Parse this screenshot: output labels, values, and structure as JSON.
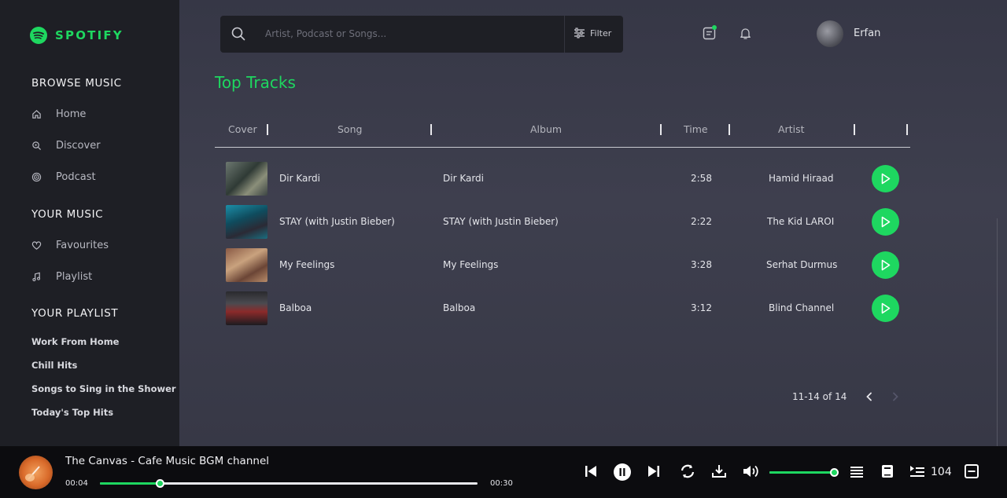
{
  "brand": {
    "name": "SPOTIFY",
    "color": "#1ed760"
  },
  "sidebar": {
    "browse_title": "BROWSE MUSIC",
    "browse_items": [
      {
        "label": "Home",
        "icon": "home-icon"
      },
      {
        "label": "Discover",
        "icon": "discover-icon"
      },
      {
        "label": "Podcast",
        "icon": "podcast-icon"
      }
    ],
    "your_music_title": "YOUR MUSIC",
    "your_music_items": [
      {
        "label": "Favourites",
        "icon": "heart-icon"
      },
      {
        "label": "Playlist",
        "icon": "music-note-icon"
      }
    ],
    "playlist_title": "YOUR PLAYLIST",
    "playlists": [
      "Work From Home",
      "Chill Hits",
      "Songs to Sing in the Shower",
      "Today's Top Hits"
    ]
  },
  "header": {
    "search_placeholder": "Artist, Podcast or Songs...",
    "filter_label": "Filter",
    "user_name": "Erfan"
  },
  "main": {
    "title": "Top Tracks",
    "columns": [
      "Cover",
      "Song",
      "Album",
      "Time",
      "Artist"
    ],
    "tracks": [
      {
        "song": "Dir Kardi",
        "album": "Dir Kardi",
        "time": "2:58",
        "artist": "Hamid Hiraad"
      },
      {
        "song": "STAY (with Justin Bieber)",
        "album": "STAY (with Justin Bieber)",
        "time": "2:22",
        "artist": "The Kid LAROI"
      },
      {
        "song": "My Feelings",
        "album": "My Feelings",
        "time": "3:28",
        "artist": "Serhat Durmus"
      },
      {
        "song": "Balboa",
        "album": "Balboa",
        "time": "3:12",
        "artist": "Blind Channel"
      }
    ],
    "pagination": "11-14 of 14"
  },
  "player": {
    "now_playing": "The Canvas - Cafe Music BGM channel",
    "current_time": "00:04",
    "duration": "00:30",
    "progress_fraction": 0.16,
    "volume_fraction": 1.0,
    "queue_count": "104"
  }
}
